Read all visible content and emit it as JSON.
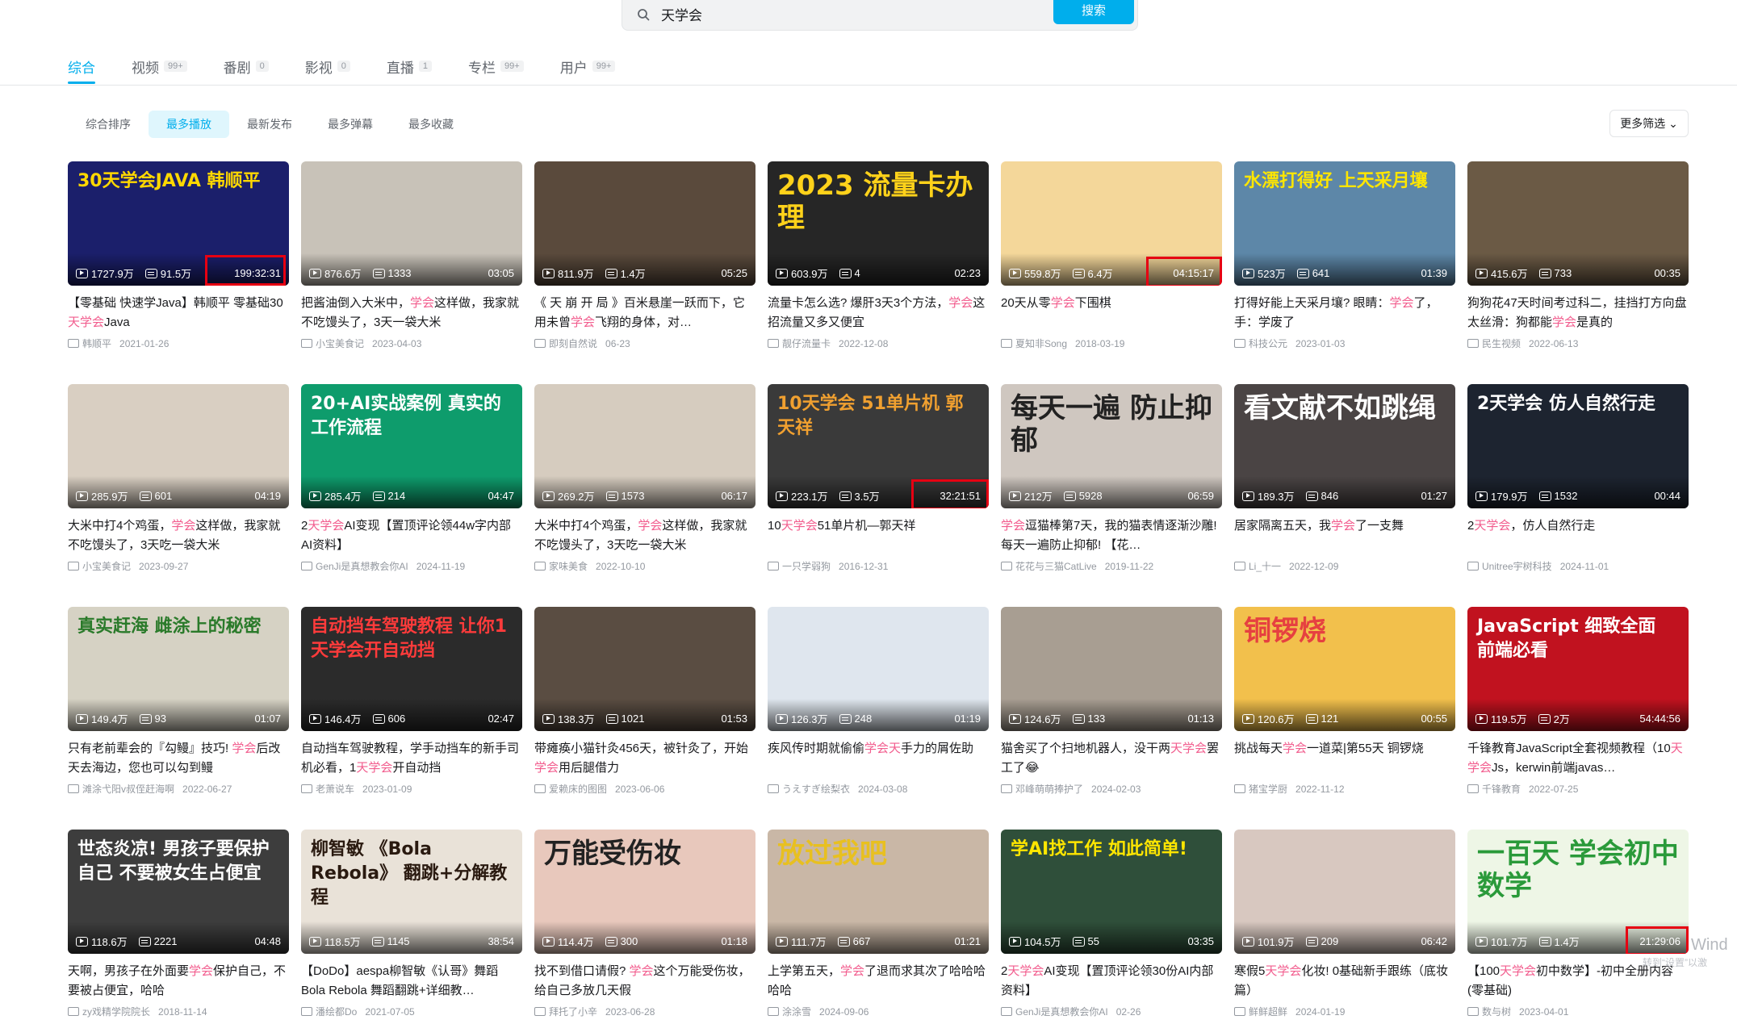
{
  "search": {
    "value": "天学会",
    "button": "搜索"
  },
  "tabs": [
    {
      "label": "综合",
      "count": ""
    },
    {
      "label": "视频",
      "count": "99+"
    },
    {
      "label": "番剧",
      "count": "0"
    },
    {
      "label": "影视",
      "count": "0"
    },
    {
      "label": "直播",
      "count": "1"
    },
    {
      "label": "专栏",
      "count": "99+"
    },
    {
      "label": "用户",
      "count": "99+"
    }
  ],
  "filters": [
    "综合排序",
    "最多播放",
    "最新发布",
    "最多弹幕",
    "最多收藏"
  ],
  "more_filter": "更多筛选",
  "colors": {
    "accent": "#00aeec",
    "highlight": "#f25d8e",
    "annotation_box": "#e60012"
  },
  "videos": [
    {
      "thumb_text": "30天学会JAVA 韩顺平",
      "bg": "#1b1f6b",
      "fg": "#ffd800",
      "views": "1727.9万",
      "danmaku": "91.5万",
      "duration": "199:32:31",
      "boxed": true,
      "title_parts": [
        "【零基础 快速学Java】韩顺平 零基础30",
        "天学会",
        "Java"
      ],
      "up": "韩顺平",
      "date": "2021-01-26"
    },
    {
      "thumb_text": "",
      "bg": "#c8c2b8",
      "fg": "#fff",
      "views": "876.6万",
      "danmaku": "1333",
      "duration": "03:05",
      "boxed": false,
      "title_parts": [
        "把酱油倒入大米中，",
        "学会",
        "这样做，我家就不吃馒头了，3天一袋大米"
      ],
      "up": "小宝美食记",
      "date": "2023-04-03"
    },
    {
      "thumb_text": "",
      "bg": "#5a4a3c",
      "fg": "#fff",
      "views": "811.9万",
      "danmaku": "1.4万",
      "duration": "05:25",
      "boxed": false,
      "title_parts": [
        "《 天 崩 开 局 》百米悬崖一跃而下，它用未曾",
        "学会",
        "飞翔的身体，对…"
      ],
      "up": "即刻自然说",
      "date": "06-23"
    },
    {
      "thumb_text": "2023 流量卡办理",
      "bg": "#262626",
      "fg": "#ffd21a",
      "views": "603.9万",
      "danmaku": "4",
      "duration": "02:23",
      "boxed": false,
      "title_parts": [
        "流量卡怎么选? 爆肝3天3个方法，",
        "学会",
        "这招流量又多又便宜"
      ],
      "up": "靓仔流量卡",
      "date": "2022-12-08"
    },
    {
      "thumb_text": "",
      "bg": "#f4d79a",
      "fg": "#333",
      "views": "559.8万",
      "danmaku": "6.4万",
      "duration": "04:15:17",
      "boxed": true,
      "title_parts": [
        "20天从零",
        "学会",
        "下围棋"
      ],
      "up": "夏知非Song",
      "date": "2018-03-19"
    },
    {
      "thumb_text": "水漂打得好 上天采月壤",
      "bg": "#5d87a8",
      "fg": "#ffe600",
      "views": "523万",
      "danmaku": "641",
      "duration": "01:39",
      "boxed": false,
      "title_parts": [
        "打得好能上天采月壤? 眼睛：",
        "学会",
        "了，手：学废了"
      ],
      "up": "科技公元",
      "date": "2023-01-03"
    },
    {
      "thumb_text": "",
      "bg": "#6b5a45",
      "fg": "#fff",
      "views": "415.6万",
      "danmaku": "733",
      "duration": "00:35",
      "boxed": false,
      "title_parts": [
        "狗狗花47天时间考过科二，挂挡打方向盘太丝滑：狗都能",
        "学会",
        "是真的"
      ],
      "up": "民生视频",
      "date": "2022-06-13"
    },
    {
      "thumb_text": "",
      "bg": "#d9cfc2",
      "fg": "#fff",
      "views": "285.9万",
      "danmaku": "601",
      "duration": "04:19",
      "boxed": false,
      "title_parts": [
        "大米中打4个鸡蛋，",
        "学会",
        "这样做，我家就不吃馒头了，3天吃一袋大米"
      ],
      "up": "小宝美食记",
      "date": "2023-09-27"
    },
    {
      "thumb_text": "20+AI实战案例 真实的工作流程",
      "bg": "#0e9c6c",
      "fg": "#ffffff",
      "views": "285.4万",
      "danmaku": "214",
      "duration": "04:47",
      "boxed": false,
      "title_parts": [
        "2",
        "天学会",
        "AI变现【置顶评论领44w字内部AI资料】"
      ],
      "up": "GenJi是真想教会你AI",
      "date": "2024-11-19"
    },
    {
      "thumb_text": "",
      "bg": "#d6ccbf",
      "fg": "#fff",
      "views": "269.2万",
      "danmaku": "1573",
      "duration": "06:17",
      "boxed": false,
      "title_parts": [
        "大米中打4个鸡蛋，",
        "学会",
        "这样做，我家就不吃馒头了，3天吃一袋大米"
      ],
      "up": "家味美食",
      "date": "2022-10-10"
    },
    {
      "thumb_text": "10天学会 51单片机 郭天祥",
      "bg": "#3a3a3a",
      "fg": "#f0a030",
      "views": "223.1万",
      "danmaku": "3.5万",
      "duration": "32:21:51",
      "boxed": true,
      "title_parts": [
        "10",
        "天学会",
        "51单片机—郭天祥"
      ],
      "up": "一只学弱狗",
      "date": "2016-12-31"
    },
    {
      "thumb_text": "每天一遍 防止抑郁",
      "bg": "#cfc7c0",
      "fg": "#222",
      "views": "212万",
      "danmaku": "5928",
      "duration": "06:59",
      "boxed": false,
      "title_parts": [
        "",
        "学会",
        "逗猫棒第7天，我的猫表情逐渐沙雕! 每天一遍防止抑郁! 【花…"
      ],
      "up": "花花与三猫CatLive",
      "date": "2019-11-22"
    },
    {
      "thumb_text": "看文献不如跳绳",
      "bg": "#4a4444",
      "fg": "#fff",
      "views": "189.3万",
      "danmaku": "846",
      "duration": "01:27",
      "boxed": false,
      "title_parts": [
        "居家隔离五天，我",
        "学会",
        "了一支舞"
      ],
      "up": "Li_十一",
      "date": "2022-12-09"
    },
    {
      "thumb_text": "2天学会 仿人自然行走",
      "bg": "#1d2430",
      "fg": "#ffffff",
      "views": "179.9万",
      "danmaku": "1532",
      "duration": "00:44",
      "boxed": false,
      "title_parts": [
        "2",
        "天学会",
        "，仿人自然行走"
      ],
      "up": "Unitree宇树科技",
      "date": "2024-11-01"
    },
    {
      "thumb_text": "真实赶海 雌涂上的秘密",
      "bg": "#d6d2c4",
      "fg": "#2a7a2a",
      "views": "149.4万",
      "danmaku": "93",
      "duration": "01:07",
      "boxed": false,
      "title_parts": [
        "只有老前辈会的『勾鳗』技巧! ",
        "学会",
        "后改天去海边，您也可以勾到鳗"
      ],
      "up": "滩涂弋阳v叔侄赶海啊",
      "date": "2022-06-27"
    },
    {
      "thumb_text": "自动挡车驾驶教程 让你1天学会开自动挡",
      "bg": "#2b2b2b",
      "fg": "#ff3b3b",
      "views": "146.4万",
      "danmaku": "606",
      "duration": "02:47",
      "boxed": false,
      "title_parts": [
        "自动挡车驾驶教程，学手动挡车的新手司机必看，1",
        "天学会",
        "开自动挡"
      ],
      "up": "老萧说车",
      "date": "2023-01-09"
    },
    {
      "thumb_text": "",
      "bg": "#5a4d42",
      "fg": "#fff",
      "views": "138.3万",
      "danmaku": "1021",
      "duration": "01:53",
      "boxed": false,
      "title_parts": [
        "带瘫痪小猫针灸456天，被针灸了，开始",
        "学会",
        "用后腿借力"
      ],
      "up": "爱赖床的图图",
      "date": "2023-06-06"
    },
    {
      "thumb_text": "",
      "bg": "#dfe6ee",
      "fg": "#e60012",
      "views": "126.3万",
      "danmaku": "248",
      "duration": "01:19",
      "boxed": false,
      "title_parts": [
        "疾风传时期就偷偷",
        "学会天",
        "手力的屑佐助"
      ],
      "up": "うえすぎ绘梨衣",
      "date": "2024-03-08"
    },
    {
      "thumb_text": "",
      "bg": "#a89e92",
      "fg": "#fff",
      "views": "124.6万",
      "danmaku": "133",
      "duration": "01:13",
      "boxed": false,
      "title_parts": [
        "猫舍买了个扫地机器人，没干两",
        "天学会",
        "罢工了😂"
      ],
      "up": "邓峰萌萌捧护了",
      "date": "2024-02-03"
    },
    {
      "thumb_text": "铜锣烧",
      "bg": "#f2c04c",
      "fg": "#e64040",
      "views": "120.6万",
      "danmaku": "121",
      "duration": "00:55",
      "boxed": false,
      "title_parts": [
        "挑战每天",
        "学会",
        "一道菜|第55天 铜锣烧"
      ],
      "up": "猪宝学厨",
      "date": "2022-11-12"
    },
    {
      "thumb_text": "JavaScript 细致全面 前端必看",
      "bg": "#c1121f",
      "fg": "#ffffff",
      "views": "119.5万",
      "danmaku": "2万",
      "duration": "54:44:56",
      "boxed": false,
      "title_parts": [
        "千锋教育JavaScript全套视频教程（10",
        "天学会",
        "Js，kerwin前端javas…"
      ],
      "up": "千锋教育",
      "date": "2022-07-25"
    },
    {
      "thumb_text": "世态炎凉! 男孩子要保护自己 不要被女生占便宜",
      "bg": "#3d3d3d",
      "fg": "#ffffff",
      "views": "118.6万",
      "danmaku": "2221",
      "duration": "04:48",
      "boxed": false,
      "title_parts": [
        "天啊，男孩子在外面要",
        "学会",
        "保护自己，不要被占便宜，哈哈"
      ],
      "up": "zy戏精学院院长",
      "date": "2018-11-14"
    },
    {
      "thumb_text": "柳智敏 《Bola Rebola》 翻跳+分解教程",
      "bg": "#e9e2d8",
      "fg": "#2a1a10",
      "views": "118.5万",
      "danmaku": "1145",
      "duration": "38:54",
      "boxed": false,
      "title_parts": [
        "【DoDo】aespa柳智敏《认哥》舞蹈Bola Rebola 舞蹈翻跳+详细教…",
        "",
        ""
      ],
      "up": "潘绘都Do",
      "date": "2021-07-05"
    },
    {
      "thumb_text": "万能受伤妆",
      "bg": "#e8c8bc",
      "fg": "#222",
      "views": "114.4万",
      "danmaku": "300",
      "duration": "01:18",
      "boxed": false,
      "title_parts": [
        "找不到借口请假? ",
        "学会",
        "这个万能受伤妆，给自己多放几天假"
      ],
      "up": "拜托了小辛",
      "date": "2023-06-28"
    },
    {
      "thumb_text": "放过我吧",
      "bg": "#c9b7a6",
      "fg": "#e8c020",
      "views": "111.7万",
      "danmaku": "667",
      "duration": "01:21",
      "boxed": false,
      "title_parts": [
        "上学第五天，",
        "学会",
        "了退而求其次了哈哈哈哈哈"
      ],
      "up": "涂涂雪",
      "date": "2024-09-06"
    },
    {
      "thumb_text": "学AI找工作 如此简单!",
      "bg": "#2f4f3a",
      "fg": "#ffe600",
      "views": "104.5万",
      "danmaku": "55",
      "duration": "03:35",
      "boxed": false,
      "title_parts": [
        "2",
        "天学会",
        "AI变现【置顶评论领30份AI内部资料】"
      ],
      "up": "GenJi是真想教会你AI",
      "date": "02-26"
    },
    {
      "thumb_text": "",
      "bg": "#d8c8c0",
      "fg": "#fff",
      "views": "101.9万",
      "danmaku": "209",
      "duration": "06:42",
      "boxed": false,
      "title_parts": [
        "寒假5",
        "天学会",
        "化妆! 0基础新手跟练（底妆篇）"
      ],
      "up": "鲜鲜超鲜",
      "date": "2024-01-19"
    },
    {
      "thumb_text": "一百天 学会初中数学",
      "bg": "#eef6e6",
      "fg": "#2a9a3a",
      "views": "101.7万",
      "danmaku": "1.4万",
      "duration": "21:29:06",
      "boxed": true,
      "title_parts": [
        "【100",
        "天学会",
        "初中数学】-初中全册内容(零基础)"
      ],
      "up": "数与树",
      "date": "2023-04-01"
    }
  ],
  "watermark": {
    "line1": "Wind",
    "line2": "转到“设置”以激"
  }
}
